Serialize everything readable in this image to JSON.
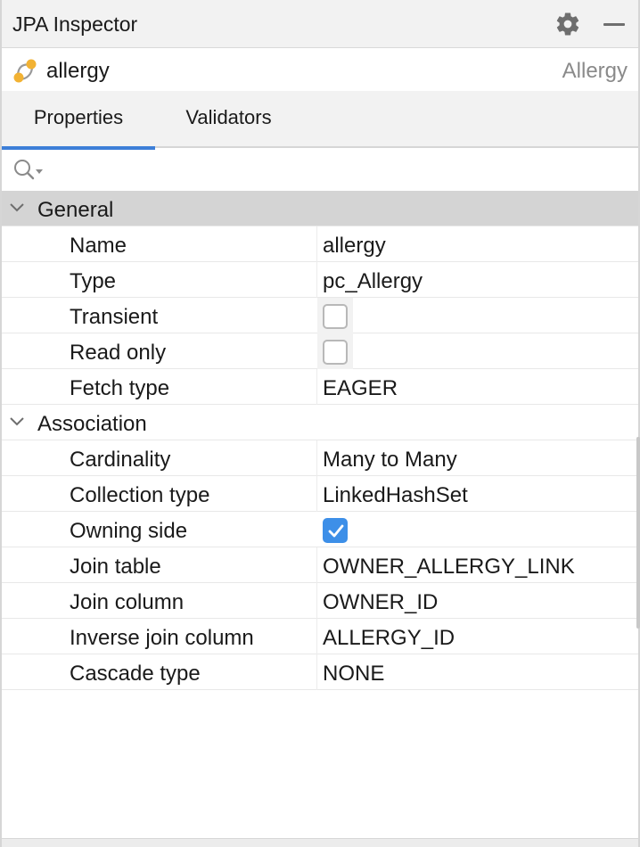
{
  "window": {
    "title": "JPA Inspector",
    "icons": {
      "settings": "gear-icon",
      "minimize": "minimize-icon"
    }
  },
  "entity": {
    "name": "allergy",
    "type": "Allergy",
    "icon": "attribute-link-icon",
    "icon_color": "#f2b233"
  },
  "tabs": [
    {
      "label": "Properties",
      "active": true
    },
    {
      "label": "Validators",
      "active": false
    }
  ],
  "search": {
    "icon": "search-icon",
    "placeholder": ""
  },
  "groups": [
    {
      "label": "General",
      "expanded": true,
      "selected": true,
      "rows": [
        {
          "name": "Name",
          "value": "allergy"
        },
        {
          "name": "Type",
          "value": "pc_Allergy"
        },
        {
          "name": "Transient",
          "checkbox": true,
          "checked": false
        },
        {
          "name": "Read only",
          "checkbox": true,
          "checked": false
        },
        {
          "name": "Fetch type",
          "value": "EAGER"
        }
      ]
    },
    {
      "label": "Association",
      "expanded": true,
      "selected": false,
      "rows": [
        {
          "name": "Cardinality",
          "value": "Many to Many"
        },
        {
          "name": "Collection type",
          "value": "LinkedHashSet"
        },
        {
          "name": "Owning side",
          "checkbox": true,
          "checked": true
        },
        {
          "name": "Join table",
          "value": "OWNER_ALLERGY_LINK"
        },
        {
          "name": "Join column",
          "value": "OWNER_ID"
        },
        {
          "name": "Inverse join column",
          "value": "ALLERGY_ID"
        },
        {
          "name": "Cascade type",
          "value": "NONE"
        }
      ]
    }
  ],
  "colors": {
    "accent": "#3d7fd8",
    "checkbox_checked": "#3d8fe8",
    "selected_group": "#d4d4d4"
  }
}
